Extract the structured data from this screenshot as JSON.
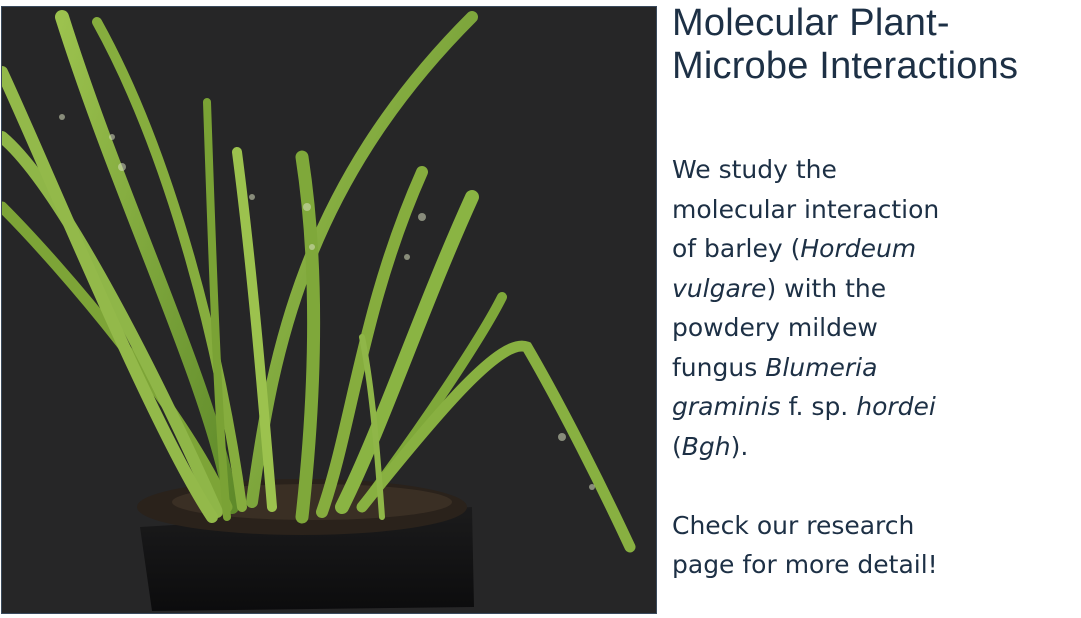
{
  "header": {
    "title_line1": "Molecular Plant-",
    "title_line2": "Microbe Interactions"
  },
  "photo": {
    "icon": "barley-plant-image",
    "background_color": "#262627"
  },
  "description": {
    "p1": "We study the molecular interaction of barley (",
    "p1_italic1": "Hordeum vulgare",
    "p1_after1": ") with the powdery mildew fungus ",
    "p1_italic2": "Blumeria graminis",
    "p1_after2": " f. sp. ",
    "p1_italic3": "hordei",
    "p1_after3": " (",
    "p1_italic4": "Bgh",
    "p1_after4": ").",
    "cta": "Check our research page for more detail!"
  },
  "colors": {
    "text": "#1d3045",
    "leaf": "#7fa83a",
    "soil": "#1e1a16"
  }
}
